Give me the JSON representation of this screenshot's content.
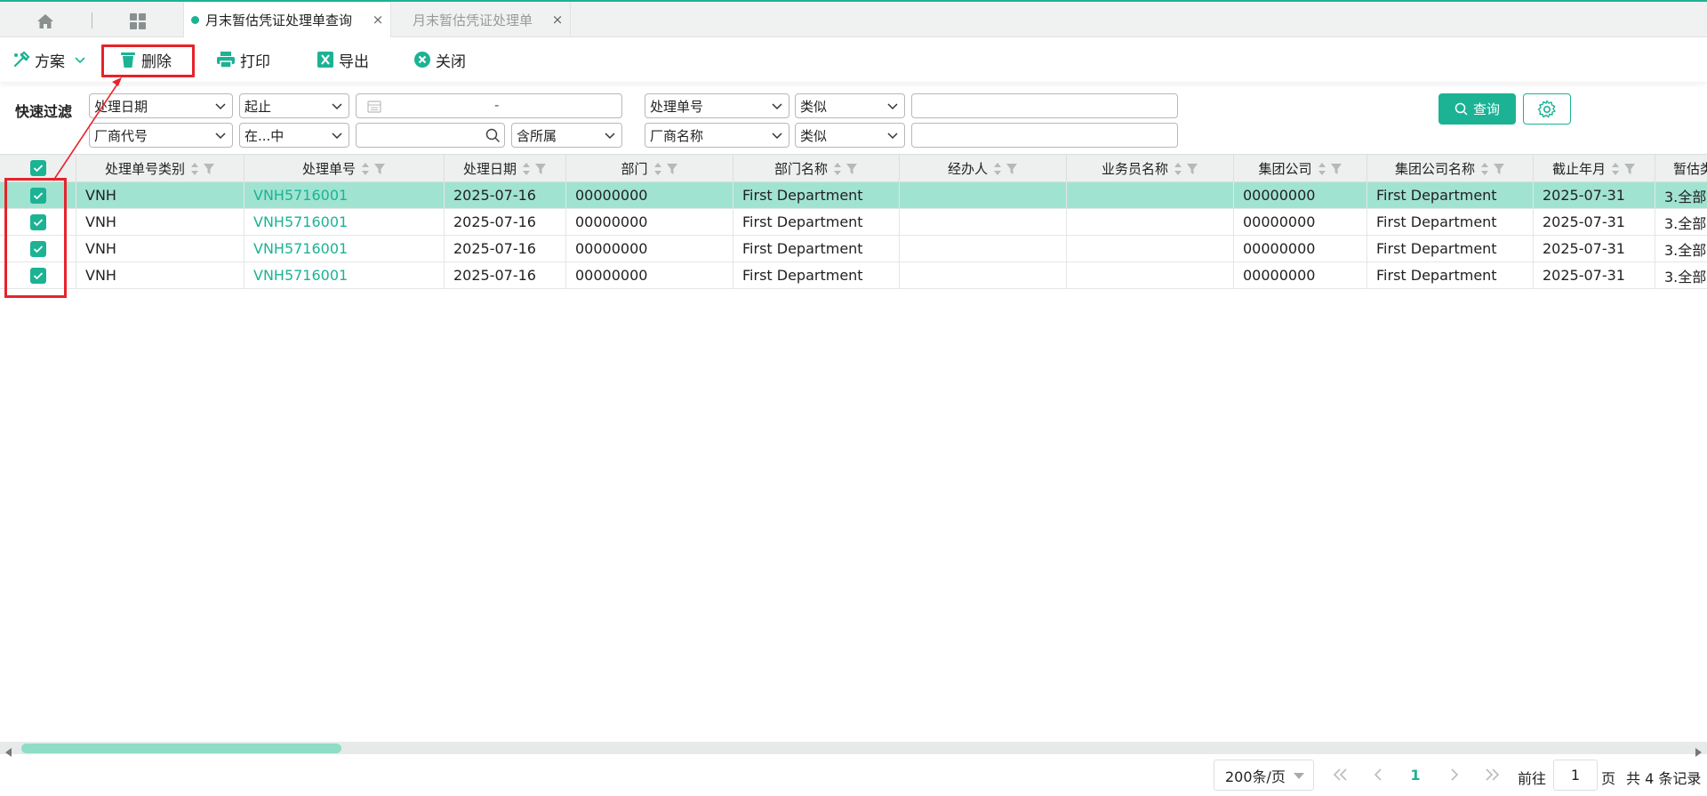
{
  "tabs": [
    {
      "label": "月末暂估凭证处理单查询",
      "active": true
    },
    {
      "label": "月末暂估凭证处理单",
      "active": false
    }
  ],
  "tab_close_glyph": "×",
  "toolbar": {
    "plan_label": "方案",
    "delete_label": "删除",
    "print_label": "打印",
    "export_label": "导出",
    "close_label": "关闭"
  },
  "filter": {
    "label": "快速过滤",
    "row1": {
      "field1": "处理日期",
      "op1": "起止",
      "date_range_sep": "-",
      "field2": "处理单号",
      "op2": "类似",
      "value2": ""
    },
    "row2": {
      "field1": "厂商代号",
      "op1": "在...中",
      "value1": "",
      "scope": "含所属",
      "field2": "厂商名称",
      "op2": "类似",
      "value2": ""
    },
    "query_label": "查询"
  },
  "table": {
    "columns": [
      "处理单号类别",
      "处理单号",
      "处理日期",
      "部门",
      "部门名称",
      "经办人",
      "业务员名称",
      "集团公司",
      "集团公司名称",
      "截止年月",
      "暂估类"
    ],
    "rows": [
      [
        "VNH",
        "VNH5716001",
        "2025-07-16",
        "00000000",
        "First Department",
        "",
        "",
        "00000000",
        "First Department",
        "2025-07-31",
        "3.全部"
      ],
      [
        "VNH",
        "VNH5716001",
        "2025-07-16",
        "00000000",
        "First Department",
        "",
        "",
        "00000000",
        "First Department",
        "2025-07-31",
        "3.全部"
      ],
      [
        "VNH",
        "VNH5716001",
        "2025-07-16",
        "00000000",
        "First Department",
        "",
        "",
        "00000000",
        "First Department",
        "2025-07-31",
        "3.全部"
      ],
      [
        "VNH",
        "VNH5716001",
        "2025-07-16",
        "00000000",
        "First Department",
        "",
        "",
        "00000000",
        "First Department",
        "2025-07-31",
        "3.全部"
      ]
    ]
  },
  "pager": {
    "page_size": "200条/页",
    "current_page": "1",
    "goto_prefix": "前往",
    "goto_value": "1",
    "goto_suffix": "页",
    "total": "共 4 条记录"
  },
  "colors": {
    "accent": "#1bb394",
    "selected_row": "#a1e3d1",
    "annotation": "#e8222b"
  },
  "icons": [
    "home-icon",
    "grid-icon",
    "plan-icon",
    "trash-icon",
    "printer-icon",
    "excel-icon",
    "close-circle-icon",
    "calendar-icon",
    "search-icon",
    "gear-icon",
    "sort-icon",
    "filter-icon",
    "check-icon"
  ]
}
